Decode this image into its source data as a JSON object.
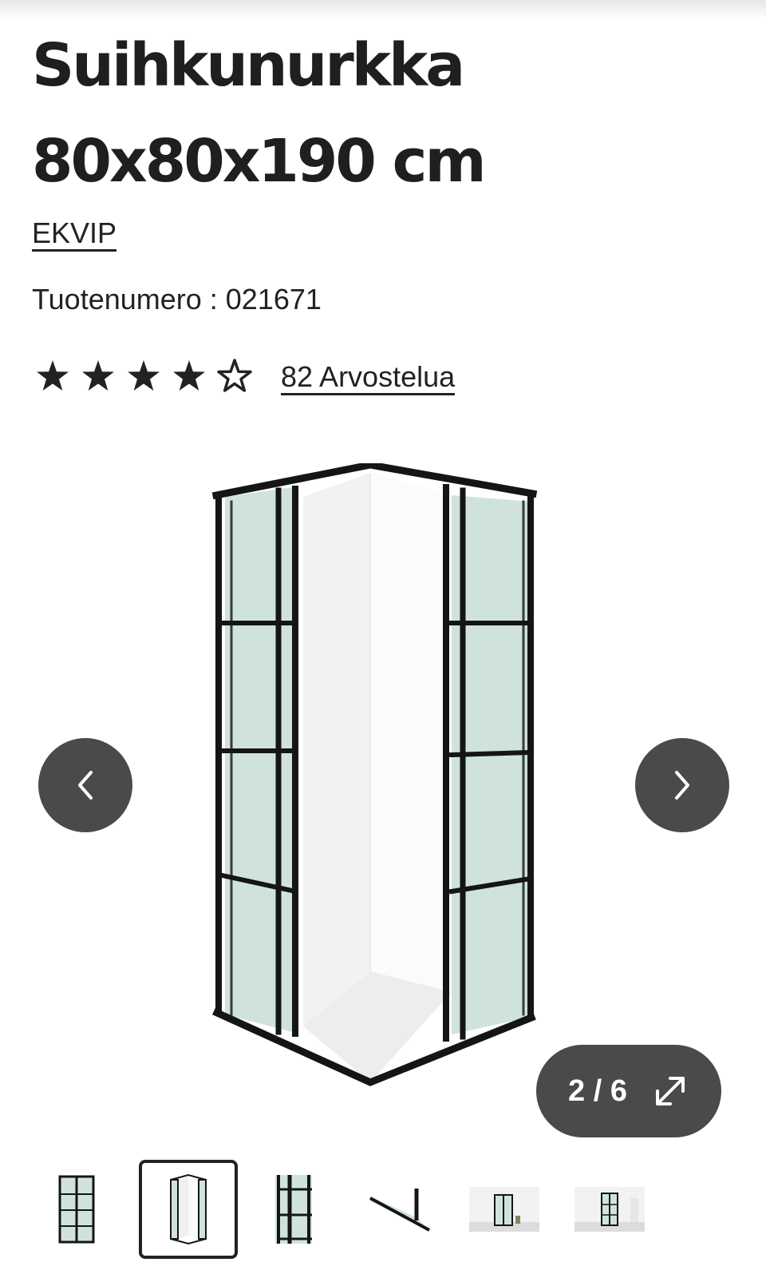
{
  "product": {
    "title": "Suihkunurkka 80x80x190 cm",
    "brand": "EKVIP",
    "sku_label": "Tuotenumero : 021671",
    "rating": 4.5,
    "rating_max": 5,
    "reviews_label": "82 Arvostelua"
  },
  "gallery": {
    "counter": "2 / 6",
    "current_index": 2,
    "total_images": 6,
    "selected_thumbnail": 2,
    "thumbnails": [
      "shower-enclosure-front-view",
      "shower-enclosure-angle-view",
      "shower-enclosure-panel-detail",
      "shower-enclosure-profile-detail",
      "shower-enclosure-bathroom-scene",
      "shower-enclosure-bathroom-scene-2"
    ]
  },
  "icons": {
    "prev": "chevron-left-icon",
    "next": "chevron-right-icon",
    "expand": "expand-icon",
    "star": "star-icon",
    "half_star": "star-half-icon"
  },
  "colors": {
    "text": "#222222",
    "button_bg": "#4a4a4a",
    "button_fg": "#ffffff",
    "glass": "#cfe3dc",
    "frame": "#151515"
  }
}
